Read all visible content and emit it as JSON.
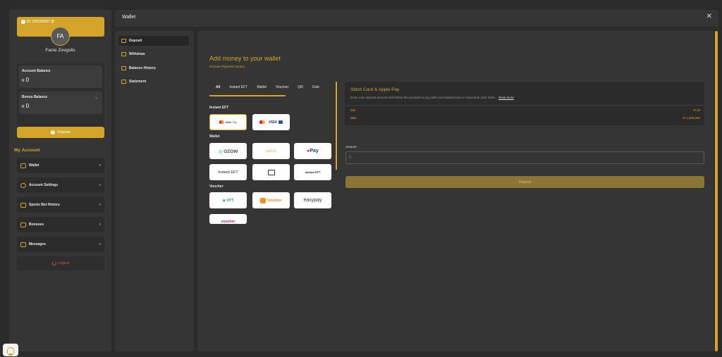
{
  "profile": {
    "id_label": "ID: 294166837",
    "initials": "FA",
    "name": "Fanie Zevgolis"
  },
  "balances": {
    "account": {
      "label": "Account Balance",
      "currency": "R",
      "value": "0"
    },
    "bonus": {
      "label": "Bonus Balance",
      "currency": "R",
      "value": "0"
    }
  },
  "sidebar": {
    "deposit_label": "Deposit",
    "my_account_title": "My Account",
    "items": [
      {
        "label": "Wallet",
        "icon": "wallet-icon"
      },
      {
        "label": "Account Settings",
        "icon": "settings-icon"
      },
      {
        "label": "Sports Bet History",
        "icon": "history-icon"
      },
      {
        "label": "Bonuses",
        "icon": "gift-icon"
      },
      {
        "label": "Messages",
        "icon": "message-icon"
      }
    ],
    "logout_label": "Logout"
  },
  "modal": {
    "title": "Wallet",
    "close_icon": "close-icon"
  },
  "wallet_nav": [
    {
      "label": "Deposit",
      "active": true
    },
    {
      "label": "Withdraw",
      "active": false
    },
    {
      "label": "Balance History",
      "active": false
    },
    {
      "label": "Statement",
      "active": false
    }
  ],
  "deposit": {
    "title": "Add money to your wallet",
    "subtitle": "Choose Payment Source",
    "tabs": [
      "All",
      "Instant EFT",
      "Wallet",
      "Voucher",
      "QR",
      "Golc"
    ],
    "sections": {
      "instant_eft": "Instant EFT",
      "wallet": "Wallet",
      "voucher": "Voucher"
    },
    "providers": {
      "stitch": {
        "visa": "VISA",
        "pay": "Pay"
      },
      "visa_mc": {
        "visa": "VISA"
      },
      "ozow": "OZOW",
      "gopay": "goPay",
      "apay": "Pay",
      "instant_eft_1": "Instant EFT",
      "instant_eft_3": "Instant EFT",
      "ott": "OTT",
      "onevoucher": "Voucher",
      "easypay": "easypay",
      "bluvoucher": "voucher"
    }
  },
  "stitch": {
    "title": "Stitch Card & Apple Pay",
    "description": "Enter your deposit amount and follow the prompts to pay with your MasterCard or Visa bank card. Ente...",
    "show_more": "show more",
    "min_label": "Min",
    "min_value": "R 10",
    "max_label": "Max",
    "max_value": "R 1,000,000"
  },
  "amount": {
    "label": "Amount",
    "required_mark": "*",
    "placeholder": "R"
  },
  "deposit_button": "Deposit",
  "colors": {
    "accent": "#d4a52a",
    "panel": "#353535",
    "background": "#2b2b2b"
  }
}
